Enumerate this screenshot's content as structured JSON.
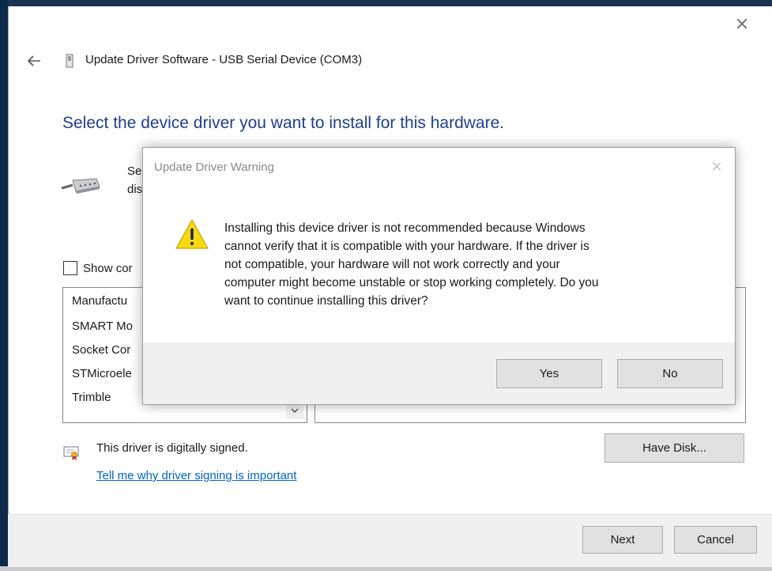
{
  "window": {
    "title": "Update Driver Software - USB Serial Device (COM3)",
    "close_glyph": "✕"
  },
  "page": {
    "heading": "Select the device driver you want to install for this hardware.",
    "description_partial": "Se\ndis",
    "show_compatible_label": "Show cor",
    "manufacturer_header": "Manufactu",
    "manufacturers": [
      "SMART Mo",
      "Socket Cor",
      "STMicroele",
      "Trimble"
    ],
    "signed_text": "This driver is digitally signed.",
    "signing_link": "Tell me why driver signing is important",
    "have_disk_label": "Have Disk...",
    "next_label": "Next",
    "cancel_label": "Cancel"
  },
  "dialog": {
    "title": "Update Driver Warning",
    "close_glyph": "✕",
    "message": "Installing this device driver is not recommended because Windows\ncannot verify that it is compatible with your hardware.  If the driver is\nnot compatible, your hardware will not work correctly and your\ncomputer might become unstable or stop working completely.  Do you\nwant to continue installing this driver?",
    "yes_label": "Yes",
    "no_label": "No"
  },
  "icons": {
    "back": "back-arrow-icon",
    "title_device": "usb-device-icon",
    "device": "serial-cable-icon",
    "certificate": "certificate-icon",
    "warning": "warning-icon",
    "dropdown": "chevron-down-icon"
  },
  "colors": {
    "heading": "#1e3f8f",
    "link": "#0066cc",
    "warning_fill": "#f6d90f"
  }
}
